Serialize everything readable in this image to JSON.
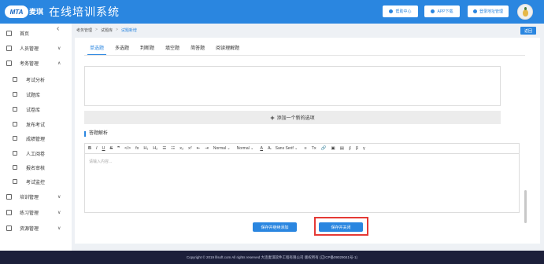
{
  "header": {
    "logo_text": "MTA",
    "logo_cn": "麦琪",
    "title": "在线培训系统",
    "buttons": [
      "帮助中心",
      "APP下载",
      "登录地址管理"
    ]
  },
  "sidebar": {
    "items": [
      {
        "label": "首页",
        "icon": "home-icon",
        "chevron": ""
      },
      {
        "label": "人员管理",
        "icon": "person-icon",
        "chevron": "∨"
      },
      {
        "label": "考务管理",
        "icon": "exam-icon",
        "chevron": "∧"
      },
      {
        "label": "考试分析",
        "icon": "analysis-icon",
        "chevron": "",
        "sub": true
      },
      {
        "label": "试题库",
        "icon": "question-bank-icon",
        "chevron": "",
        "sub": true
      },
      {
        "label": "试卷库",
        "icon": "paper-bank-icon",
        "chevron": "",
        "sub": true
      },
      {
        "label": "发布考试",
        "icon": "publish-icon",
        "chevron": "",
        "sub": true
      },
      {
        "label": "成绩管理",
        "icon": "score-icon",
        "chevron": "",
        "sub": true
      },
      {
        "label": "人工阅卷",
        "icon": "grading-icon",
        "chevron": "",
        "sub": true
      },
      {
        "label": "报名审核",
        "icon": "review-icon",
        "chevron": "",
        "sub": true
      },
      {
        "label": "考试监控",
        "icon": "monitor-icon",
        "chevron": "",
        "sub": true
      },
      {
        "label": "培训管理",
        "icon": "training-icon",
        "chevron": "∨"
      },
      {
        "label": "练习管理",
        "icon": "practice-icon",
        "chevron": "∨"
      },
      {
        "label": "资源管理",
        "icon": "resource-icon",
        "chevron": "∨"
      }
    ]
  },
  "breadcrumb": {
    "items": [
      "考务管理",
      "试题库"
    ],
    "current": "试题新增",
    "separator": ">"
  },
  "back_label": "返回",
  "tabs": [
    "单选题",
    "多选题",
    "判断题",
    "填空题",
    "简答题",
    "阅读理解题"
  ],
  "active_tab": "单选题",
  "add_option_label": "添加一个新的选项",
  "analysis_title": "答题解析",
  "toolbar": {
    "buttons": [
      "B",
      "I",
      "U",
      "S",
      "❞",
      "</>",
      "fx",
      "H₁",
      "H₂",
      "☰",
      "☷",
      "x₂",
      "x²",
      "⇤",
      "⇥"
    ],
    "selects": [
      "Normal",
      "Normal"
    ],
    "color_buttons": [
      "A",
      "A̶"
    ],
    "font_select": "Sans Serif",
    "tail_buttons": [
      "≡",
      "Tx",
      "🔗",
      "▣",
      "▤",
      "∮",
      "β",
      "γ"
    ]
  },
  "editor_placeholder": "请输入内容...",
  "actions": {
    "save_and_continue": "保存并继续添加",
    "save_and_close": "保存并关闭"
  },
  "footer_text": "Copyright © 2019 lllsoft.com All rights reserved 大连麦琪软件工程有限公司 版权所有 (辽ICP备09029041号-1)",
  "colors": {
    "primary": "#2a86e0",
    "highlight": "#e53935",
    "footer_bg": "#1c1f3a"
  }
}
